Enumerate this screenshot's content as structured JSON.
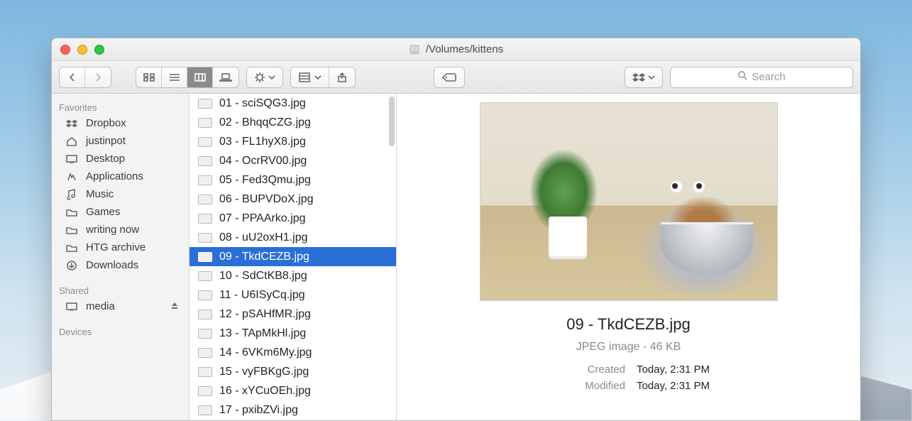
{
  "window": {
    "path": "/Volumes/kittens"
  },
  "search": {
    "placeholder": "Search"
  },
  "sidebar": {
    "sections": [
      {
        "label": "Favorites",
        "items": [
          {
            "label": "Dropbox"
          },
          {
            "label": "justinpot"
          },
          {
            "label": "Desktop"
          },
          {
            "label": "Applications"
          },
          {
            "label": "Music"
          },
          {
            "label": "Games"
          },
          {
            "label": "writing now"
          },
          {
            "label": "HTG archive"
          },
          {
            "label": "Downloads"
          }
        ]
      },
      {
        "label": "Shared",
        "items": [
          {
            "label": "media"
          }
        ]
      },
      {
        "label": "Devices",
        "items": []
      }
    ]
  },
  "files": {
    "selected_index": 8,
    "items": [
      {
        "name": "01 - sciSQG3.jpg"
      },
      {
        "name": "02 - BhqqCZG.jpg"
      },
      {
        "name": "03 - FL1hyX8.jpg"
      },
      {
        "name": "04 - OcrRV00.jpg"
      },
      {
        "name": "05 - Fed3Qmu.jpg"
      },
      {
        "name": "06 - BUPVDoX.jpg"
      },
      {
        "name": "07 - PPAArko.jpg"
      },
      {
        "name": "08 - uU2oxH1.jpg"
      },
      {
        "name": "09 - TkdCEZB.jpg"
      },
      {
        "name": "10 - SdCtKB8.jpg"
      },
      {
        "name": "11 - U6ISyCq.jpg"
      },
      {
        "name": "12 - pSAHfMR.jpg"
      },
      {
        "name": "13 - TApMkHl.jpg"
      },
      {
        "name": "14 - 6VKm6My.jpg"
      },
      {
        "name": "15 - vyFBKgG.jpg"
      },
      {
        "name": "16 - xYCuOEh.jpg"
      },
      {
        "name": "17 - pxibZVi.jpg"
      }
    ]
  },
  "preview": {
    "name": "09 - TkdCEZB.jpg",
    "kind": "JPEG image - 46 KB",
    "created_key": "Created",
    "created_val": "Today, 2:31 PM",
    "modified_key": "Modified",
    "modified_val": "Today, 2:31 PM"
  }
}
